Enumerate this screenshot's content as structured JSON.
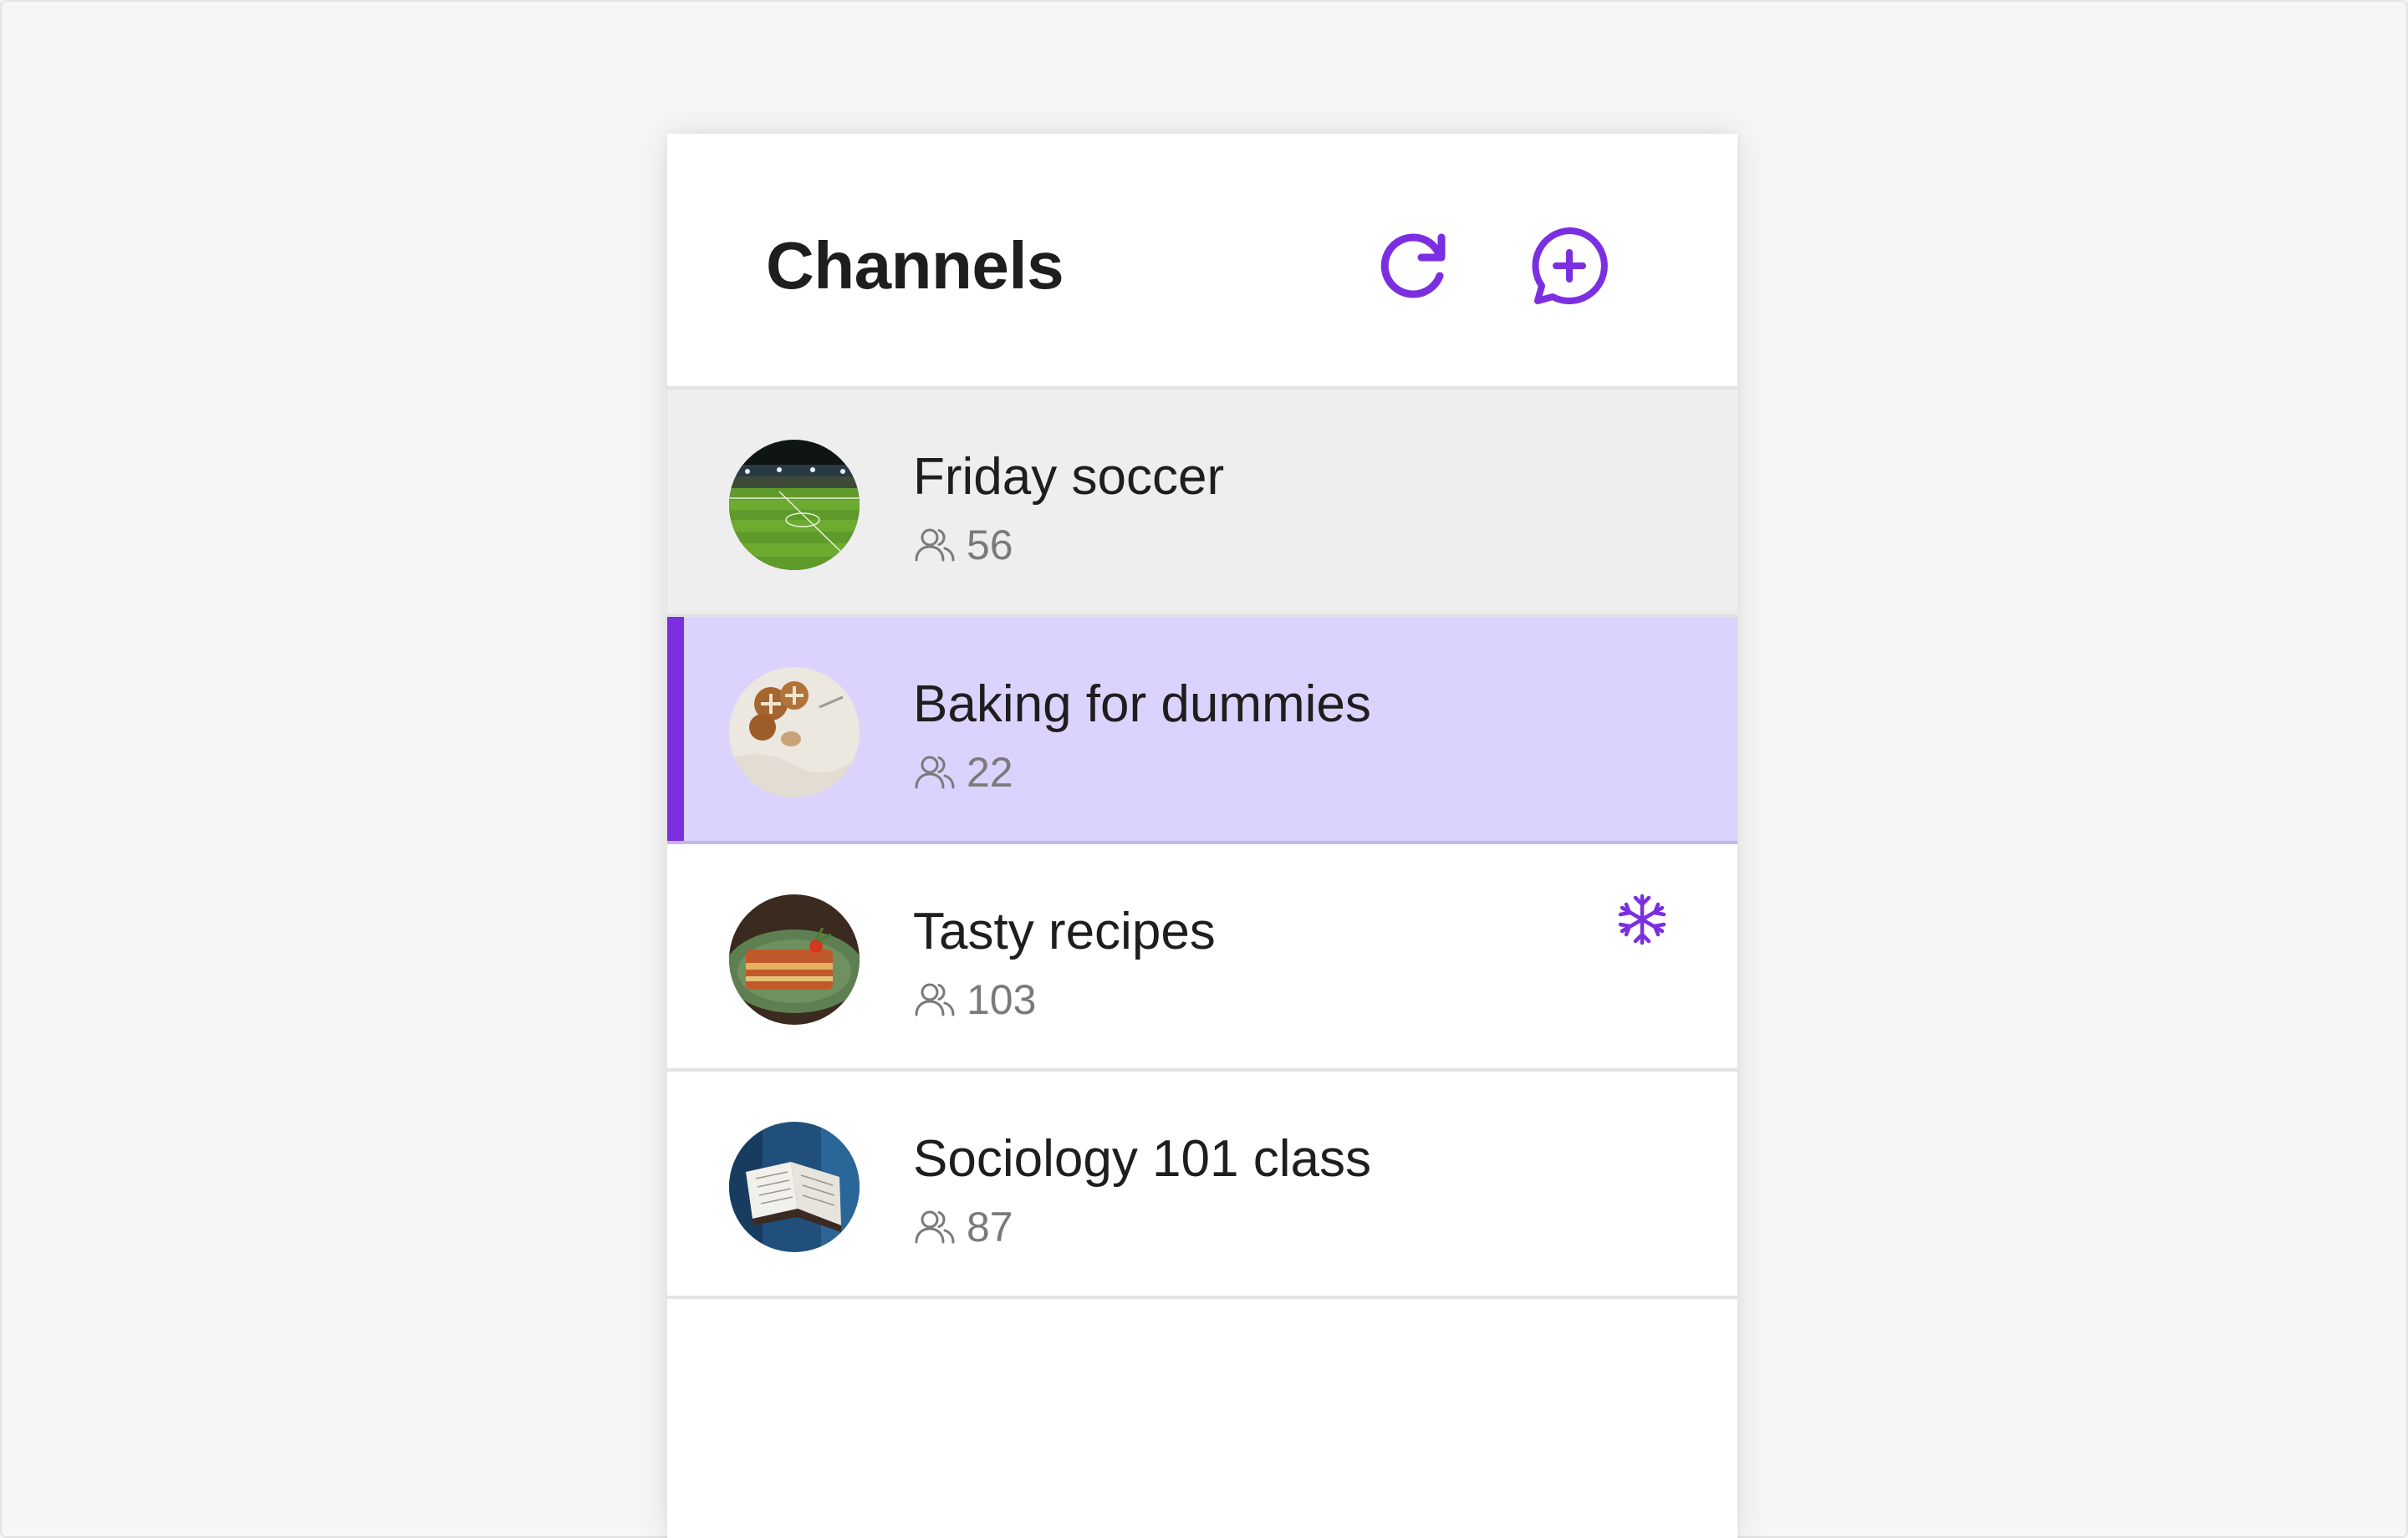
{
  "header": {
    "title": "Channels",
    "refresh_icon": "refresh-icon",
    "new_channel_icon": "chat-plus-icon"
  },
  "colors": {
    "accent": "#7B2FE0",
    "active_row_bg": "#DBD3FD",
    "muted_row_bg": "#EEEEEE",
    "text": "#1E1E1E",
    "secondary_text": "#7A7A7A"
  },
  "channels": [
    {
      "name": "Friday soccer",
      "members": "56",
      "state": "muted",
      "avatar": "soccer-stadium",
      "frozen": false
    },
    {
      "name": "Baking for dummies",
      "members": "22",
      "state": "active",
      "avatar": "hot-cross-buns",
      "frozen": false
    },
    {
      "name": "Tasty recipes",
      "members": "103",
      "state": "normal",
      "avatar": "lasagna",
      "frozen": true,
      "status_icon": "snowflake-icon"
    },
    {
      "name": "Sociology 101 class",
      "members": "87",
      "state": "normal",
      "avatar": "open-book",
      "frozen": false
    }
  ]
}
